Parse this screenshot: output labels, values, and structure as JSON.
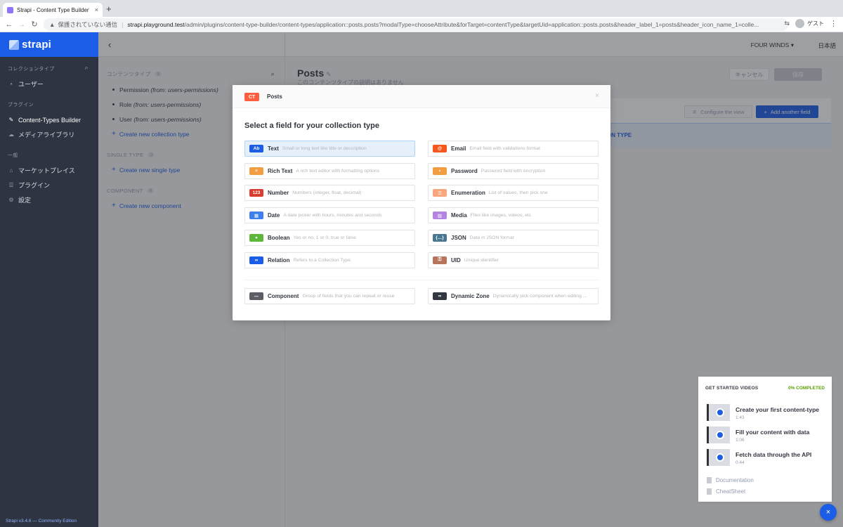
{
  "browser": {
    "tab_title": "Strapi - Content Type Builder",
    "new_tab": "+",
    "close": "×",
    "insecure_label": "保護されていない通信",
    "url_host": "strapi.playground.test",
    "url_path": "/admin/plugins/content-type-builder/content-types/application::posts.posts?modalType=chooseAttribute&forTarget=contentType&targetUid=application::posts.posts&header_label_1=posts&header_icon_name_1=colle...",
    "guest_label": "ゲスト"
  },
  "sidebar": {
    "brand": "strapi",
    "collection_types_heading": "コレクションタイプ",
    "collection_items": [
      {
        "label": "ユーザー"
      }
    ],
    "plugins_heading": "プラグイン",
    "plugin_items": [
      {
        "label": "Content-Types Builder",
        "icon": "pencil-icon"
      },
      {
        "label": "メディアライブラリ",
        "icon": "cloud-upload-icon"
      }
    ],
    "general_heading": "一般",
    "general_items": [
      {
        "label": "マーケットプレイス",
        "icon": "shop-icon"
      },
      {
        "label": "プラグイン",
        "icon": "list-icon"
      },
      {
        "label": "設定",
        "icon": "gear-icon"
      }
    ],
    "footer": "Strapi v3.4.6 — Community Edition"
  },
  "ctb_menu": {
    "content_types_heading": "コンテンツタイプ",
    "content_types_count": "3",
    "content_types": [
      {
        "name": "Permission",
        "source": "(from: users-permissions)"
      },
      {
        "name": "Role",
        "source": "(from: users-permissions)"
      },
      {
        "name": "User",
        "source": "(from: users-permissions)"
      }
    ],
    "create_collection": "Create new collection type",
    "single_type_heading": "SINGLE TYPE",
    "single_type_count": "0",
    "create_single": "Create new single type",
    "component_heading": "COMPONENT",
    "component_count": "0",
    "create_component": "Create new component"
  },
  "header": {
    "tenant": "FOUR WINDS",
    "language": "日本語"
  },
  "main": {
    "title": "Posts",
    "description": "このコンテンツタイプの説明はありません",
    "cancel": "キャンセル",
    "save": "保存",
    "configure_view": "Configure the view",
    "add_field": "Add another field",
    "strip_text": "ON TYPE"
  },
  "modal": {
    "badge": "CT",
    "name": "Posts",
    "close": "×",
    "title": "Select a field for your collection type",
    "fields": [
      {
        "name": "Text",
        "desc": "Small or long text like title or description",
        "icon": "text-icon",
        "glyph": "Ab",
        "color": "#1c5de7",
        "selected": true
      },
      {
        "name": "Email",
        "desc": "Email field with validations format",
        "icon": "at-icon",
        "glyph": "@",
        "color": "#f6571f",
        "selected": false
      },
      {
        "name": "Rich Text",
        "desc": "A rich text editor with formatting options",
        "icon": "richtext-icon",
        "glyph": "≡",
        "color": "#f29d41",
        "selected": false
      },
      {
        "name": "Password",
        "desc": "Password field with encryption",
        "icon": "lock-icon",
        "glyph": "▪",
        "color": "#f29d41",
        "selected": false
      },
      {
        "name": "Number",
        "desc": "Numbers (integer, float, decimal)",
        "icon": "number-icon",
        "glyph": "123",
        "color": "#da3c2f",
        "selected": false
      },
      {
        "name": "Enumeration",
        "desc": "List of values, then pick one",
        "icon": "list-icon",
        "glyph": "☰",
        "color": "#f9a57e",
        "selected": false
      },
      {
        "name": "Date",
        "desc": "A date picker with hours, minutes and seconds",
        "icon": "calendar-icon",
        "glyph": "▦",
        "color": "#3f7fec",
        "selected": false
      },
      {
        "name": "Media",
        "desc": "Files like images, videos, etc",
        "icon": "image-icon",
        "glyph": "▨",
        "color": "#b385e0",
        "selected": false
      },
      {
        "name": "Boolean",
        "desc": "Yes or no, 1 or 0, true or false",
        "icon": "toggle-icon",
        "glyph": "●",
        "color": "#5fb73a",
        "selected": false
      },
      {
        "name": "JSON",
        "desc": "Data in JSON format",
        "icon": "braces-icon",
        "glyph": "{…}",
        "color": "#49778f",
        "selected": false
      },
      {
        "name": "Relation",
        "desc": "Refers to a Collection Type",
        "icon": "link-icon",
        "glyph": "∞",
        "color": "#1c5de7",
        "selected": false
      },
      {
        "name": "UID",
        "desc": "Unique identifier",
        "icon": "key-icon",
        "glyph": "⚿",
        "color": "#b7745c",
        "selected": false
      },
      {
        "name": "Component",
        "desc": "Group of fields that you can repeat or reuse",
        "icon": "component-icon",
        "glyph": "⋯",
        "color": "#5b5f65",
        "selected": false
      },
      {
        "name": "Dynamic Zone",
        "desc": "Dynamically pick component when editing ...",
        "icon": "infinity-icon",
        "glyph": "∞",
        "color": "#333740",
        "selected": false
      }
    ]
  },
  "videos": {
    "heading": "GET STARTED VIDEOS",
    "completed": "0% COMPLETED",
    "completed_fraction": 0,
    "items": [
      {
        "title": "Create your first content-type",
        "duration": "1:43"
      },
      {
        "title": "Fill your content with data",
        "duration": "1:06"
      },
      {
        "title": "Fetch data through the API",
        "duration": "0:44"
      }
    ],
    "links": [
      {
        "label": "Documentation",
        "icon": "book-icon"
      },
      {
        "label": "CheatSheet",
        "icon": "file-icon"
      }
    ]
  }
}
